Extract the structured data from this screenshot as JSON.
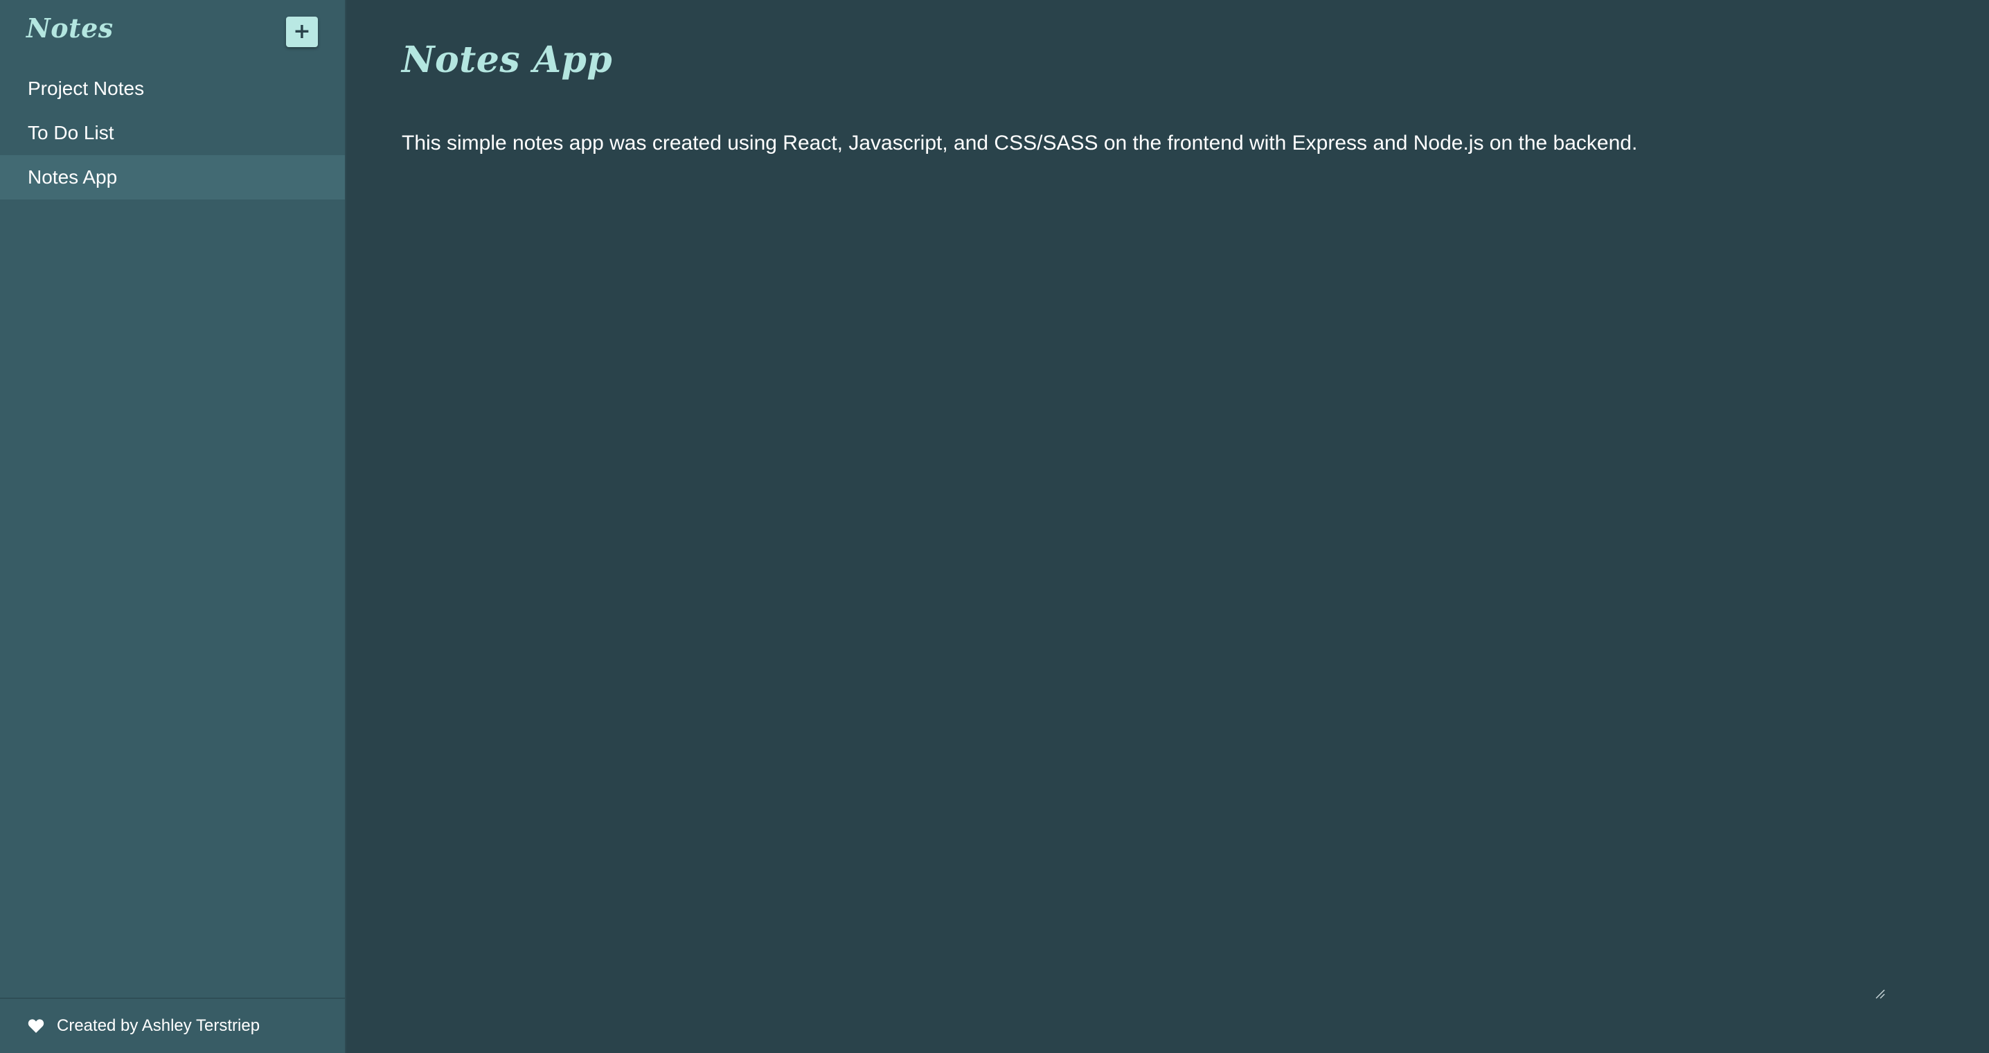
{
  "sidebar": {
    "title": "Notes",
    "add_button": {
      "icon": "plus-icon",
      "glyph": "+"
    },
    "items": [
      {
        "label": "Project Notes",
        "active": false
      },
      {
        "label": "To Do List",
        "active": false
      },
      {
        "label": "Notes App",
        "active": true
      }
    ],
    "footer": {
      "icon": "heart-icon",
      "text": "Created by Ashley Terstriep"
    }
  },
  "note": {
    "title": "Notes App",
    "body": "This simple notes app was created using React, Javascript, and CSS/SASS on the frontend with Express and Node.js on the backend."
  },
  "colors": {
    "sidebar_bg": "#385c65",
    "main_bg": "#2a434b",
    "accent": "#b4e6e0",
    "active_item_bg": "#426a73",
    "text": "#ffffff"
  }
}
